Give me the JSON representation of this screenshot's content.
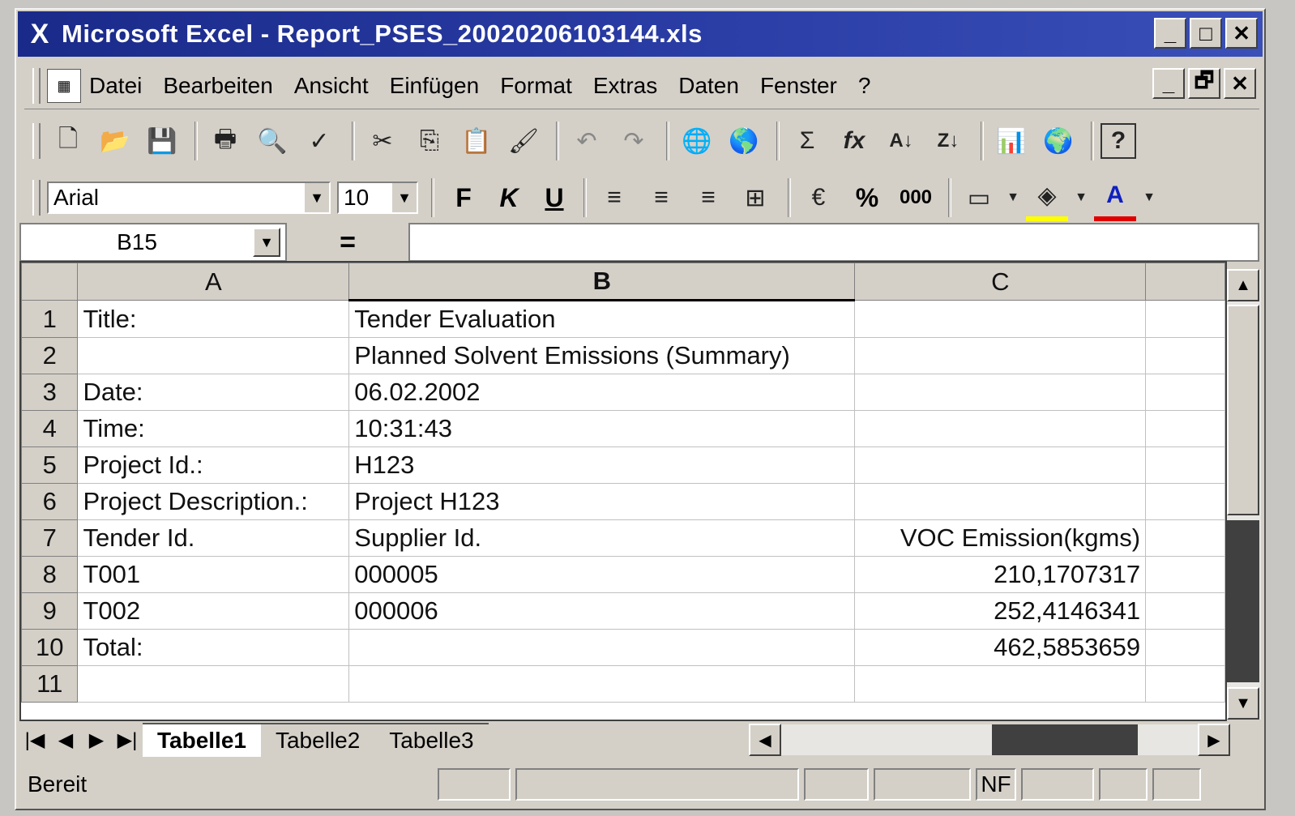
{
  "window": {
    "title": "Microsoft Excel - Report_PSES_20020206103144.xls",
    "app_icon": "excel-icon",
    "minimize": "_",
    "maximize": "□",
    "close": "✕",
    "restore": "🗗"
  },
  "menu": [
    "Datei",
    "Bearbeiten",
    "Ansicht",
    "Einfügen",
    "Format",
    "Extras",
    "Daten",
    "Fenster",
    "?"
  ],
  "toolbar_icons": [
    "new-icon",
    "open-icon",
    "save-icon",
    "print-icon",
    "print-preview-icon",
    "spelling-icon",
    "cut-icon",
    "copy-icon",
    "paste-icon",
    "format-painter-icon",
    "undo-icon",
    "redo-icon",
    "web-icon",
    "hyperlink-icon",
    "autosum-icon",
    "function-icon",
    "sort-ascending-icon",
    "sort-descending-icon",
    "chart-wizard-icon",
    "map-icon",
    "help-icon"
  ],
  "toolbar_glyphs": [
    "🗋",
    "📂",
    "💾",
    "🖶",
    "🔍",
    "✓",
    "✂",
    "⎘",
    "📋",
    "🖌",
    "↶",
    "↷",
    "🌐",
    "🌎",
    "Σ",
    "fx",
    "A↓",
    "Z↓",
    "📊",
    "🌍",
    "?"
  ],
  "format": {
    "font": "Arial",
    "size": "10",
    "bold": "F",
    "italic": "K",
    "underline": "U",
    "align_left": "≡",
    "align_center": "≡",
    "align_right": "≡",
    "merge": "⊞",
    "currency": "€",
    "percent": "%",
    "thousands": "000",
    "font_color": "A"
  },
  "formula_bar": {
    "name_box": "B15",
    "equals": "=",
    "formula": ""
  },
  "columns": [
    "A",
    "B",
    "C"
  ],
  "rows": [
    {
      "n": "1",
      "a": "Title:",
      "b": "Tender Evaluation",
      "c": ""
    },
    {
      "n": "2",
      "a": "",
      "b": "Planned Solvent Emissions (Summary)",
      "c": ""
    },
    {
      "n": "3",
      "a": "Date:",
      "b": "06.02.2002",
      "c": ""
    },
    {
      "n": "4",
      "a": "Time:",
      "b": "10:31:43",
      "c": ""
    },
    {
      "n": "5",
      "a": "Project Id.:",
      "b": "H123",
      "c": ""
    },
    {
      "n": "6",
      "a": "Project Description.:",
      "b": "Project H123",
      "c": ""
    },
    {
      "n": "7",
      "a": "Tender Id.",
      "b": "Supplier Id.",
      "c": "VOC Emission(kgms)"
    },
    {
      "n": "8",
      "a": "T001",
      "b": "000005",
      "c": "210,1707317"
    },
    {
      "n": "9",
      "a": "T002",
      "b": "000006",
      "c": "252,4146341"
    },
    {
      "n": "10",
      "a": "Total:",
      "b": "",
      "c": "462,5853659"
    },
    {
      "n": "11",
      "a": "",
      "b": "",
      "c": ""
    }
  ],
  "sheets": [
    "Tabelle1",
    "Tabelle2",
    "Tabelle3"
  ],
  "tab_nav": [
    "|◀",
    "◀",
    "▶",
    "▶|"
  ],
  "status": {
    "text": "Bereit",
    "indicator": "NF"
  }
}
